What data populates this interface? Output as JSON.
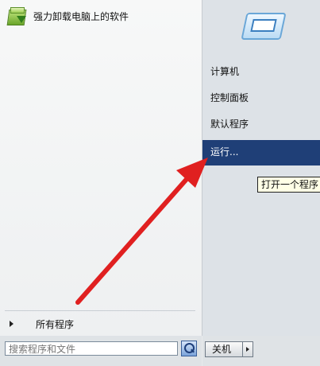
{
  "recent_programs": [
    {
      "label": "强力卸载电脑上的软件",
      "icon": "uninstall-box-icon"
    }
  ],
  "all_programs": {
    "label": "所有程序",
    "icon": "triangle-right-icon"
  },
  "search": {
    "value": "",
    "placeholder": "搜索程序和文件",
    "icon": "magnifier-icon"
  },
  "user_picture": {
    "icon": "user-picture-icon"
  },
  "right_menu": [
    {
      "label": "计算机"
    },
    {
      "label": "控制面板"
    },
    {
      "label": "默认程序"
    },
    {
      "label": "运行...",
      "selected": true
    }
  ],
  "tooltip": {
    "text": "打开一个程序"
  },
  "shutdown": {
    "label": "关机",
    "arrow_icon": "triangle-right-icon"
  },
  "colors": {
    "selection": "#1f3f77",
    "annotation_arrow": "#e02020"
  }
}
